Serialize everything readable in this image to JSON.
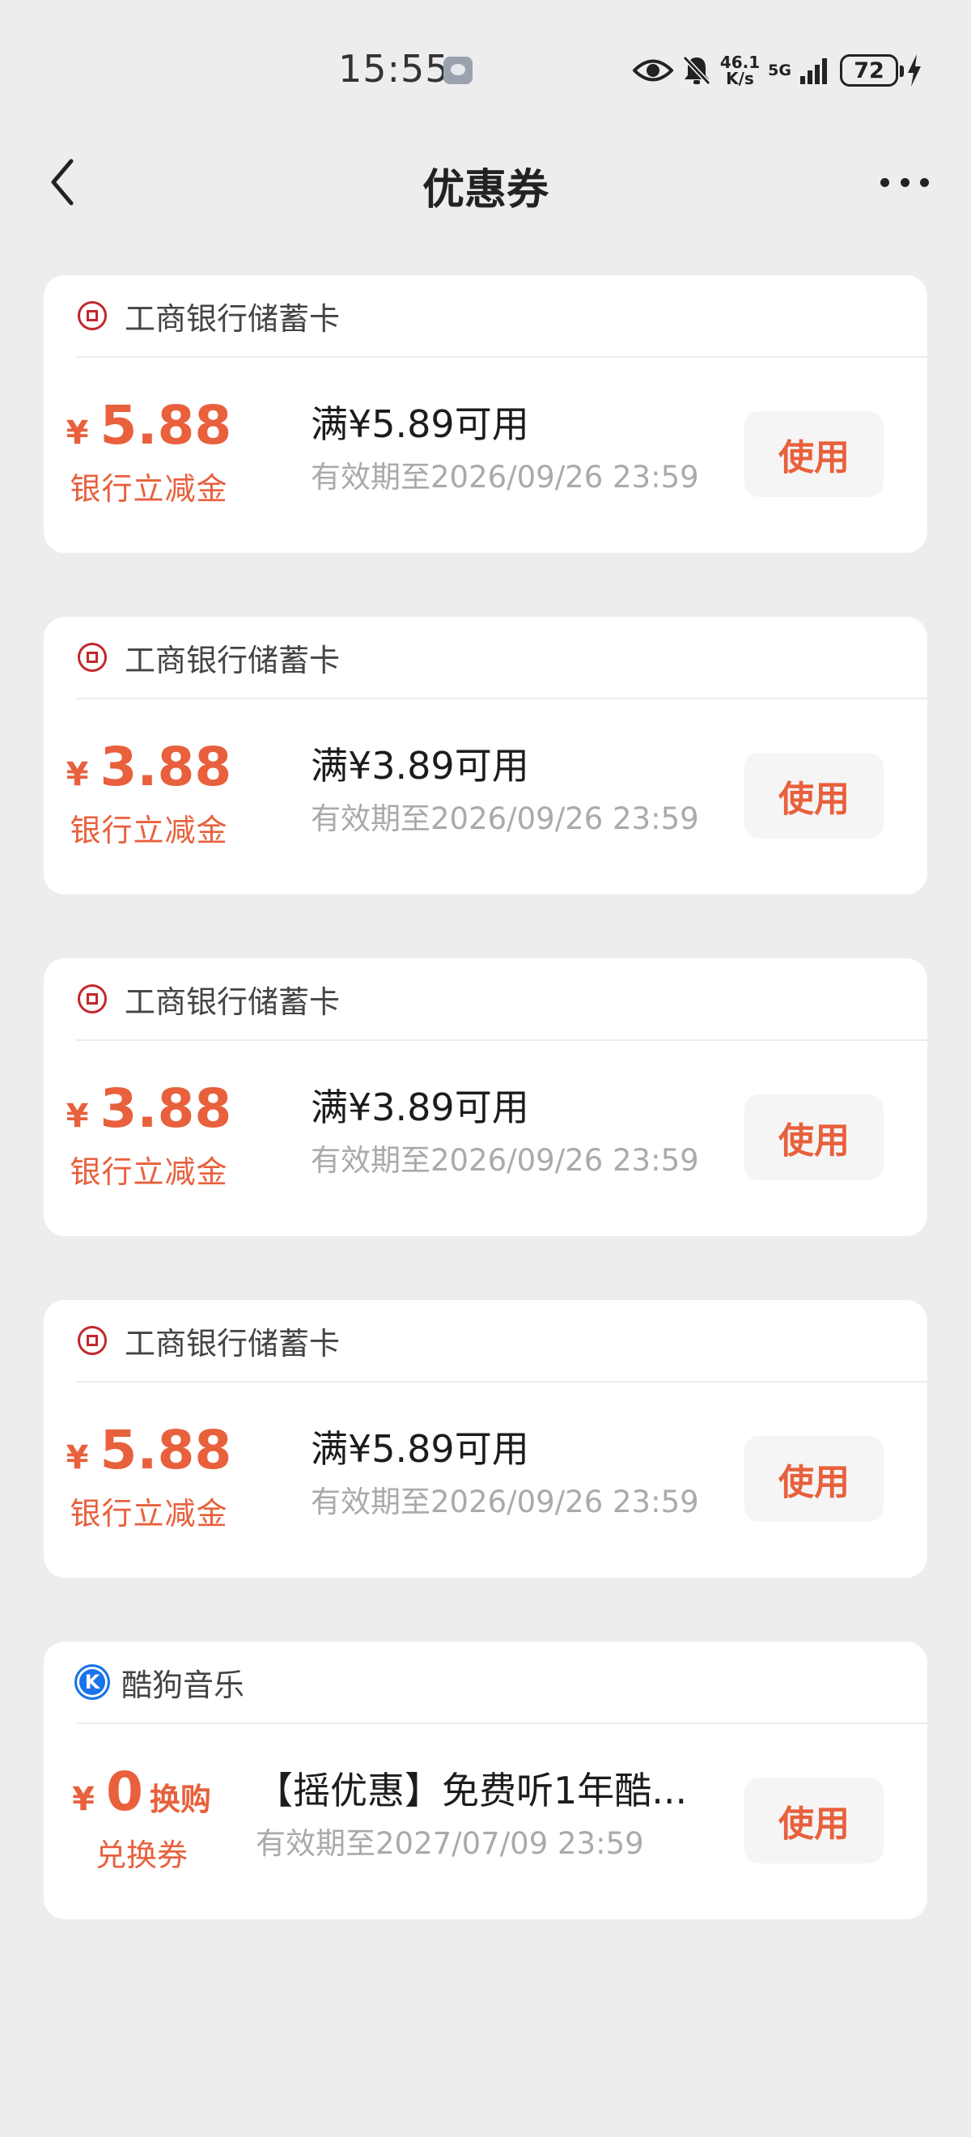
{
  "status_bar": {
    "time": "15:55",
    "net_speed_value": "46.1",
    "net_speed_unit": "K/s",
    "network": "5G",
    "battery": "72"
  },
  "nav": {
    "title": "优惠券"
  },
  "coupons": [
    {
      "merchant": "工商银行储蓄卡",
      "currency": "¥",
      "amount": "5.88",
      "amount_suffix": "",
      "type": "银行立减金",
      "condition": "满¥5.89可用",
      "validity": "有效期至2026/09/26 23:59",
      "button": "使用"
    },
    {
      "merchant": "工商银行储蓄卡",
      "currency": "¥",
      "amount": "3.88",
      "amount_suffix": "",
      "type": "银行立减金",
      "condition": "满¥3.89可用",
      "validity": "有效期至2026/09/26 23:59",
      "button": "使用"
    },
    {
      "merchant": "工商银行储蓄卡",
      "currency": "¥",
      "amount": "3.88",
      "amount_suffix": "",
      "type": "银行立减金",
      "condition": "满¥3.89可用",
      "validity": "有效期至2026/09/26 23:59",
      "button": "使用"
    },
    {
      "merchant": "工商银行储蓄卡",
      "currency": "¥",
      "amount": "5.88",
      "amount_suffix": "",
      "type": "银行立减金",
      "condition": "满¥5.89可用",
      "validity": "有效期至2026/09/26 23:59",
      "button": "使用"
    },
    {
      "merchant": "酷狗音乐",
      "logo_letter": "K",
      "currency": "¥",
      "amount": "0",
      "amount_suffix": "换购",
      "type": "兑换券",
      "condition": "【摇优惠】免费听1年酷...",
      "validity": "有效期至2027/07/09 23:59",
      "button": "使用"
    }
  ],
  "colors": {
    "accent": "#e8603c",
    "icbc_red": "#c3272b",
    "kugou_blue": "#1a73e8",
    "background": "#ededed"
  },
  "icons": {
    "back": "chevron-left-icon",
    "more": "more-dots-icon",
    "icbc": "icbc-logo-icon",
    "kugou": "kugou-logo-icon"
  }
}
